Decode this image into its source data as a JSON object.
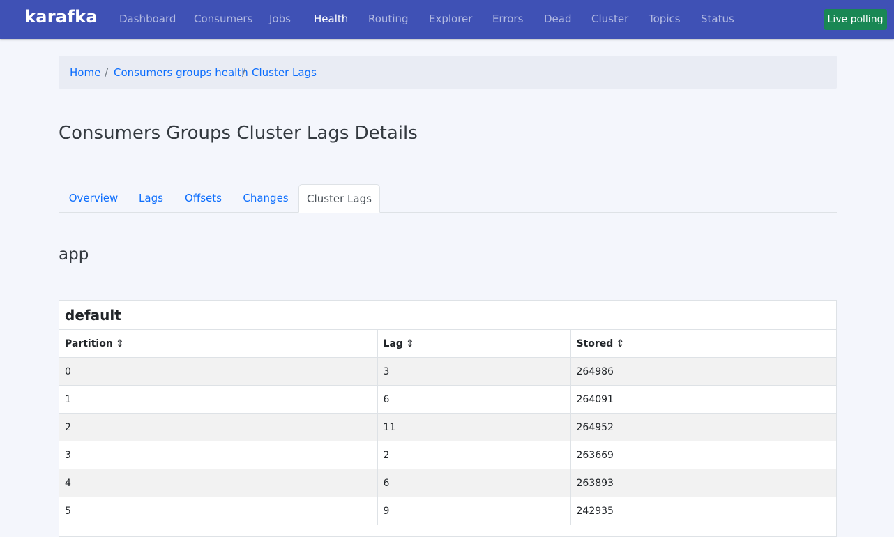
{
  "nav": {
    "brand": "karafka",
    "items": [
      {
        "label": "Dashboard",
        "active": false
      },
      {
        "label": "Consumers",
        "active": false
      },
      {
        "label": "Jobs",
        "active": false
      },
      {
        "label": "Health",
        "active": true
      },
      {
        "label": "Routing",
        "active": false
      },
      {
        "label": "Explorer",
        "active": false
      },
      {
        "label": "Errors",
        "active": false
      },
      {
        "label": "Dead",
        "active": false
      },
      {
        "label": "Cluster",
        "active": false
      },
      {
        "label": "Topics",
        "active": false
      },
      {
        "label": "Status",
        "active": false
      }
    ],
    "live_polling_label": "Live polling"
  },
  "breadcrumb": {
    "items": [
      "Home",
      "Consumers groups health",
      "Cluster Lags"
    ],
    "separator": "/"
  },
  "page": {
    "title": "Consumers Groups Cluster Lags Details"
  },
  "tabs": [
    {
      "label": "Overview",
      "active": false
    },
    {
      "label": "Lags",
      "active": false
    },
    {
      "label": "Offsets",
      "active": false
    },
    {
      "label": "Changes",
      "active": false
    },
    {
      "label": "Cluster Lags",
      "active": true
    }
  ],
  "group": {
    "name": "app",
    "topic": {
      "name": "default",
      "sort_icon": "⇕",
      "columns": [
        "Partition",
        "Lag",
        "Stored"
      ],
      "rows": [
        [
          "0",
          "3",
          "264986"
        ],
        [
          "1",
          "6",
          "264091"
        ],
        [
          "2",
          "11",
          "264952"
        ],
        [
          "3",
          "2",
          "263669"
        ],
        [
          "4",
          "6",
          "263893"
        ],
        [
          "5",
          "9",
          "242935"
        ]
      ]
    }
  }
}
